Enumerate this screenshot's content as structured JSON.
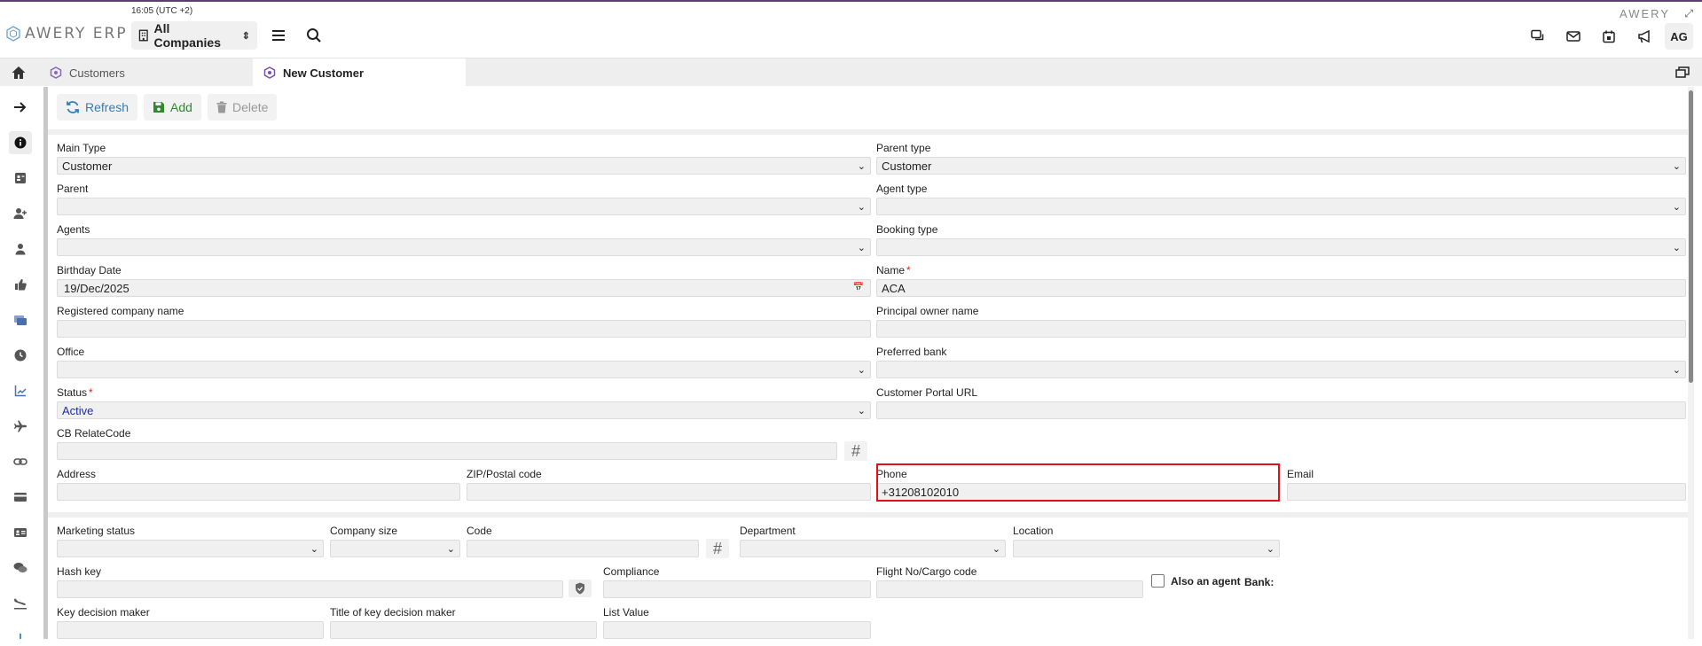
{
  "app": {
    "logo_text": "AWERY ERP",
    "brand_right": "AWERY",
    "clock": "16:05 (UTC +2)"
  },
  "header": {
    "company_select": "All Companies",
    "user_initials": "AG",
    "icons": [
      "chat-icon",
      "mail-icon",
      "calendar-icon",
      "megaphone-icon"
    ]
  },
  "tabs": [
    {
      "label": "Customers",
      "active": false
    },
    {
      "label": "New Customer",
      "active": true
    }
  ],
  "toolbar": {
    "refresh": "Refresh",
    "add": "Add",
    "delete": "Delete"
  },
  "form": {
    "main_type": {
      "label": "Main Type",
      "value": "Customer"
    },
    "parent_type": {
      "label": "Parent type",
      "value": "Customer"
    },
    "parent": {
      "label": "Parent",
      "value": ""
    },
    "agent_type": {
      "label": "Agent type",
      "value": ""
    },
    "agents": {
      "label": "Agents",
      "value": ""
    },
    "booking_type": {
      "label": "Booking type",
      "value": ""
    },
    "birthday_date": {
      "label": "Birthday Date",
      "value": "19/Dec/2025"
    },
    "name": {
      "label": "Name",
      "value": "ACA",
      "required": "*"
    },
    "registered_company_name": {
      "label": "Registered company name",
      "value": ""
    },
    "principal_owner_name": {
      "label": "Principal owner name",
      "value": ""
    },
    "office": {
      "label": "Office",
      "value": ""
    },
    "preferred_bank": {
      "label": "Preferred bank",
      "value": ""
    },
    "status": {
      "label": "Status",
      "value": "Active",
      "required": "*"
    },
    "customer_portal_url": {
      "label": "Customer Portal URL",
      "value": ""
    },
    "cb_relate_code": {
      "label": "CB RelateCode",
      "value": ""
    },
    "address": {
      "label": "Address",
      "value": ""
    },
    "zip": {
      "label": "ZIP/Postal code",
      "value": ""
    },
    "phone": {
      "label": "Phone",
      "value": "+31208102010"
    },
    "email": {
      "label": "Email",
      "value": ""
    },
    "marketing_status": {
      "label": "Marketing status",
      "value": ""
    },
    "company_size": {
      "label": "Company size",
      "value": ""
    },
    "code": {
      "label": "Code",
      "value": ""
    },
    "department": {
      "label": "Department",
      "value": ""
    },
    "location": {
      "label": "Location",
      "value": ""
    },
    "hash_key": {
      "label": "Hash key",
      "value": ""
    },
    "compliance": {
      "label": "Compliance",
      "value": ""
    },
    "flight_no": {
      "label": "Flight No/Cargo code",
      "value": ""
    },
    "also_agent": {
      "label": "Also an agent",
      "checked": false
    },
    "bank": {
      "label": "Bank:"
    },
    "key_decision_maker": {
      "label": "Key decision maker",
      "value": ""
    },
    "title_key_decision_maker": {
      "label": "Title of key decision maker",
      "value": ""
    },
    "list_value": {
      "label": "List Value",
      "value": ""
    }
  },
  "hash_symbol": "#",
  "colors": {
    "accent": "#2d7fc0",
    "add": "#2f8a2f",
    "highlight": "#e0101a",
    "status_active": "#1a2bb0",
    "top_line": "#5a3f6e"
  }
}
